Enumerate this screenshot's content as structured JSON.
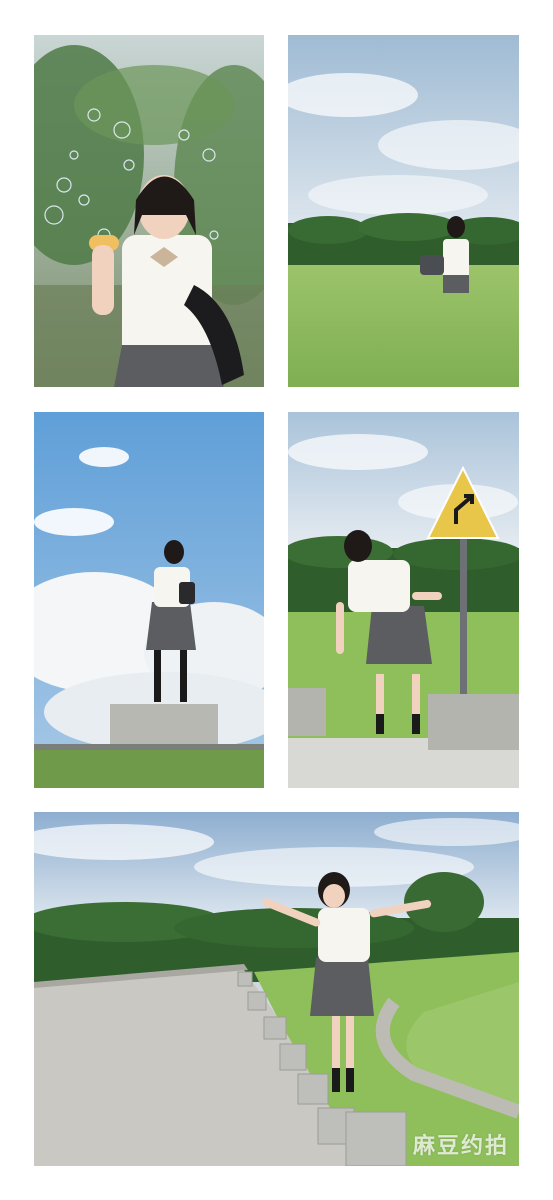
{
  "collage": {
    "photos": [
      {
        "scene": "bubbles"
      },
      {
        "scene": "field"
      },
      {
        "scene": "sky-pedestal"
      },
      {
        "scene": "road-sign"
      },
      {
        "scene": "curved-road"
      }
    ],
    "watermark": "麻豆约拍"
  },
  "colors": {
    "sky_blue": "#7fb3dc",
    "cloud": "#f4f6f8",
    "grass": "#8fbf5a",
    "trees": "#2f5e2c",
    "skirt": "#5c5d61",
    "shirt": "#f7f5f0",
    "sign_yellow": "#e8c64a"
  }
}
